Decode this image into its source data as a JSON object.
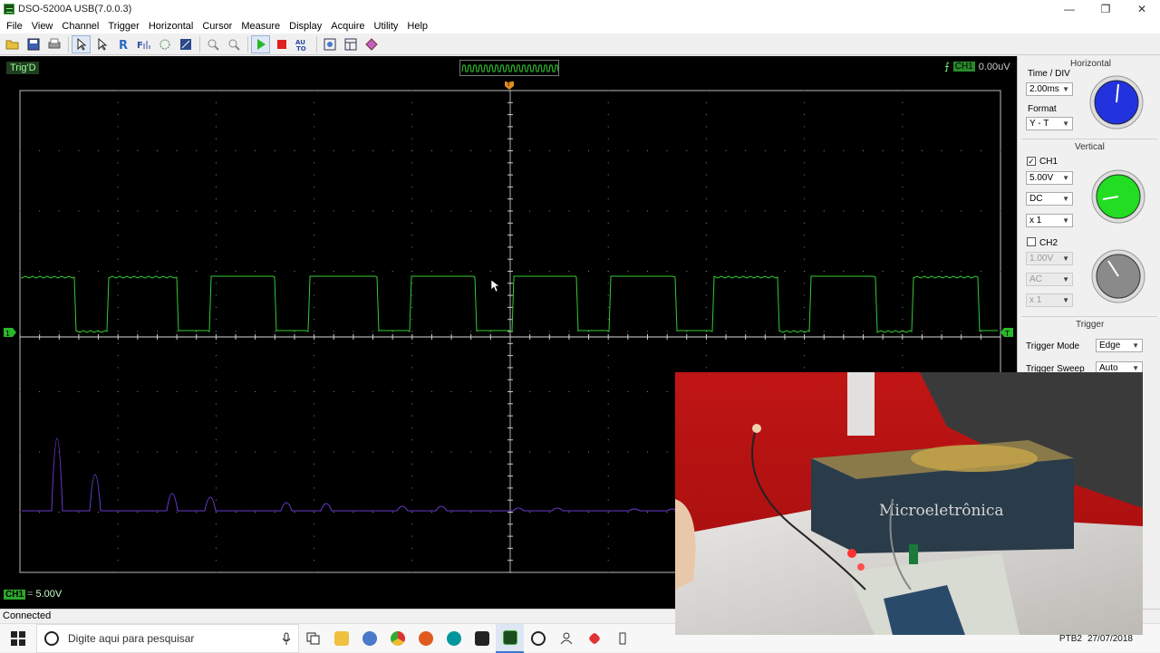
{
  "window": {
    "title": "DSO-5200A USB(7.0.0.3)",
    "minimize": "—",
    "maximize": "❐",
    "close": "✕"
  },
  "menu": [
    "File",
    "View",
    "Channel",
    "Trigger",
    "Horizontal",
    "Cursor",
    "Measure",
    "Display",
    "Acquire",
    "Utility",
    "Help"
  ],
  "toolbar": {
    "icons": [
      "open-icon",
      "save-icon",
      "print-icon",
      "select-icon",
      "pointer-icon",
      "reference-icon",
      "fft-icon",
      "math-icon",
      "measure-icon",
      "zoom-in-icon",
      "zoom-out-icon",
      "run-icon",
      "stop-icon",
      "autoset-icon",
      "screenshot-icon",
      "layout-icon",
      "record-icon"
    ]
  },
  "scope": {
    "trigger_status": "Trig'D",
    "trigger_channel": "CH1",
    "trigger_level": "0.00uV",
    "ch1_label": "CH1",
    "ch1_scale": "5.00V",
    "ch1_marker": "1",
    "trigger_marker": "T",
    "position_marker": "T",
    "colors": {
      "ch1": "#33cc33",
      "ch2": "#6633cc",
      "grid": "#aaaaaa"
    }
  },
  "panel": {
    "horizontal": {
      "title": "Horizontal",
      "time_div_label": "Time / DIV",
      "time_div_value": "2.00ms",
      "format_label": "Format",
      "format_value": "Y - T",
      "knob_color": "#2233dd"
    },
    "vertical": {
      "title": "Vertical",
      "ch1": {
        "label": "CH1",
        "checked": "✓",
        "volts": "5.00V",
        "coupling": "DC",
        "probe": "x 1",
        "knob_color": "#22dd22"
      },
      "ch2": {
        "label": "CH2",
        "checked": "",
        "volts": "1.00V",
        "coupling": "AC",
        "probe": "x 1",
        "knob_color": "#888888"
      }
    },
    "trigger": {
      "title": "Trigger",
      "mode_label": "Trigger Mode",
      "mode_value": "Edge",
      "sweep_label": "Trigger Sweep",
      "sweep_value": "Auto"
    }
  },
  "statusbar": {
    "text": "Connected"
  },
  "taskbar": {
    "search_placeholder": "Digite aqui para pesquisar",
    "tray_lang": "PTB2",
    "tray_date": "27/07/2018"
  },
  "overlay": {
    "book_title": "Microeletrônica"
  }
}
